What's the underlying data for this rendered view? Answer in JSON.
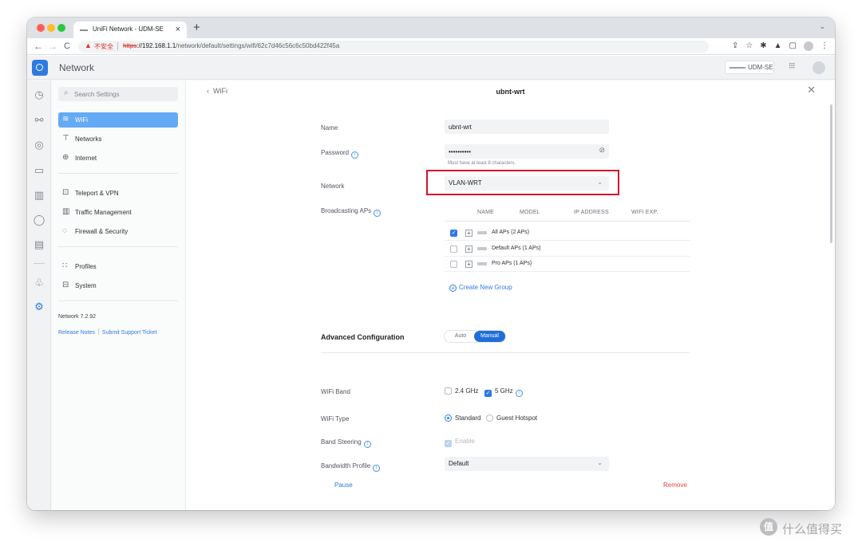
{
  "browser": {
    "tab_title": "UniFi Network - UDM-SE",
    "tab_close": "×",
    "new_tab": "+",
    "tab_menu": "⌄",
    "insecure_label": "不安全",
    "url_scheme": "https",
    "url_host": "://192.168.1.1",
    "url_path": "/network/default/settings/wifi/62c7d46c56c6c50bd422f45a",
    "back": "←",
    "forward": "→",
    "reload": "C"
  },
  "app": {
    "title": "Network",
    "device_name": "UDM-SE"
  },
  "sidebar": {
    "search_placeholder": "Search Settings",
    "items": [
      {
        "label": "WiFi",
        "icon": "wifi-icon"
      },
      {
        "label": "Networks",
        "icon": "networks-icon"
      },
      {
        "label": "Internet",
        "icon": "globe-icon"
      },
      {
        "label": "Teleport & VPN",
        "icon": "teleport-icon"
      },
      {
        "label": "Traffic Management",
        "icon": "traffic-icon"
      },
      {
        "label": "Firewall & Security",
        "icon": "shield-icon"
      },
      {
        "label": "Profiles",
        "icon": "profiles-icon"
      },
      {
        "label": "System",
        "icon": "system-icon"
      }
    ],
    "version": "Network 7.2.92",
    "release_notes": "Release Notes",
    "support": "Submit Support Ticket"
  },
  "panel": {
    "back_label": "WiFi",
    "title": "ubnt-wrt",
    "name_label": "Name",
    "name_value": "ubnt-wrt",
    "password_label": "Password",
    "password_value": "••••••••••",
    "password_hint": "Must have at least 8 characters.",
    "network_label": "Network",
    "network_value": "VLAN-WRT",
    "broadcasting_label": "Broadcasting APs",
    "columns": [
      "NAME",
      "MODEL",
      "IP ADDRESS",
      "WIFI EXP."
    ],
    "ap_rows": [
      {
        "name": "All APs (2 APs)",
        "checked": true
      },
      {
        "name": "Default APs (1 APs)",
        "checked": false
      },
      {
        "name": "Pro APs (1 APs)",
        "checked": false
      }
    ],
    "create_group": "Create New Group",
    "advanced_title": "Advanced Configuration",
    "mode_auto": "Auto",
    "mode_manual": "Manual",
    "band_label": "WiFi Band",
    "band_24": "2.4 GHz",
    "band_5": "5 GHz",
    "type_label": "WiFi Type",
    "type_standard": "Standard",
    "type_guest": "Guest Hotspot",
    "steering_label": "Band Steering",
    "steering_option": "Enable",
    "bandwidth_label": "Bandwidth Profile",
    "bandwidth_value": "Default",
    "pause": "Pause",
    "remove": "Remove"
  },
  "watermark": {
    "logo_char": "值",
    "text": "什么值得买"
  },
  "colors": {
    "accent": "#2e7be0",
    "sidebar_active": "#64aaf5",
    "highlight_box": "#d0142c",
    "danger": "#e0433f"
  }
}
